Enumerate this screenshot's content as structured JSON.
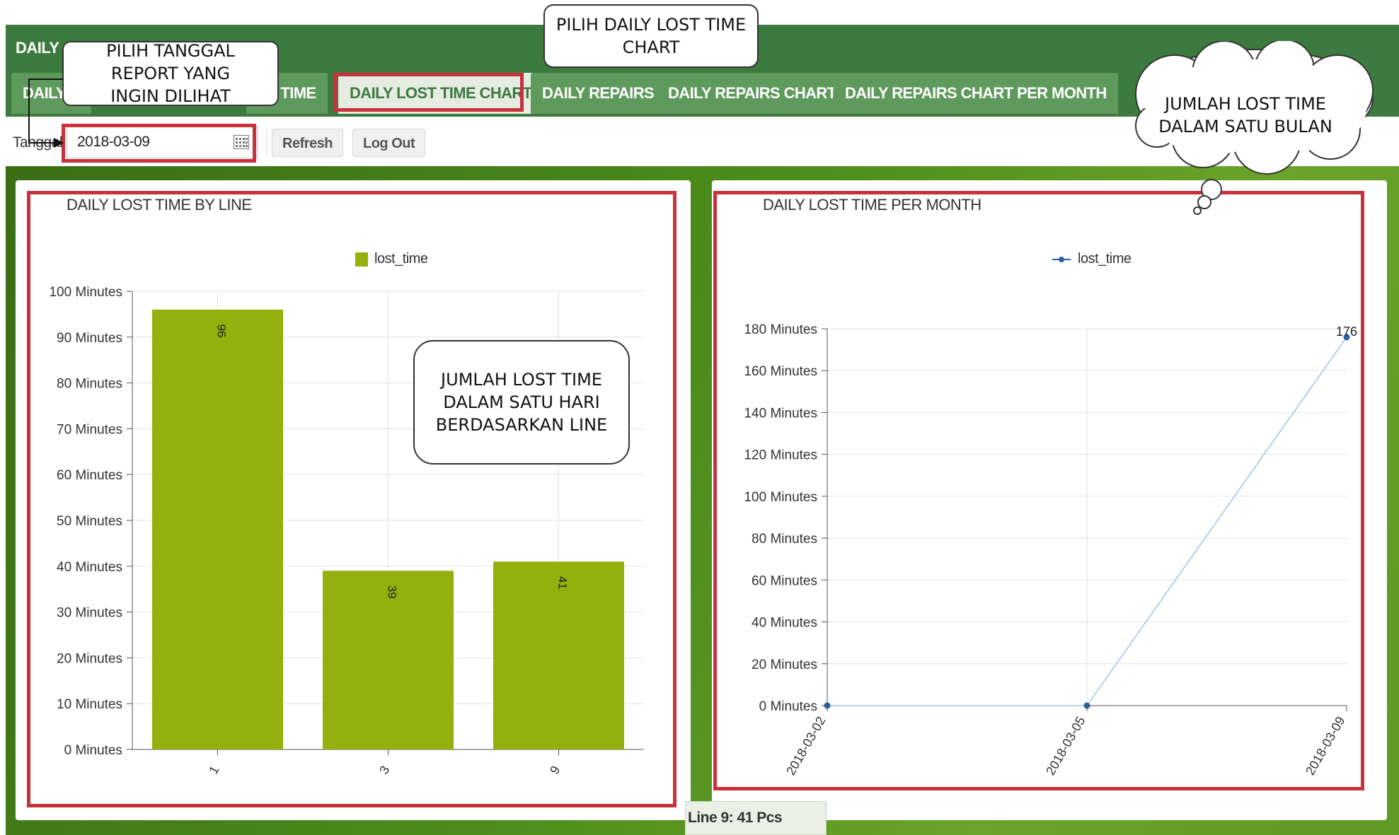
{
  "header": {
    "title": "DAILY C",
    "tabs": [
      {
        "label": "DAILY C"
      },
      {
        "label": "T TIME"
      },
      {
        "label": "DAILY LOST TIME CHART"
      },
      {
        "label": "DAILY REPAIRS"
      },
      {
        "label": "DAILY REPAIRS CHART"
      },
      {
        "label": "DAILY REPAIRS CHART PER MONTH"
      }
    ],
    "active_tab": "DAILY LOST TIME CHART"
  },
  "toolbar": {
    "date_label": "Tanggal",
    "date_value": "2018-03-09",
    "refresh_label": "Refresh",
    "logout_label": "Log Out"
  },
  "status_bar": {
    "text": "Line 9: 41 Pcs"
  },
  "annotations": {
    "pick_date": "PILIH TANGGAL REPORT YANG INGIN DILIHAT",
    "pick_chart": "PILIH DAILY LOST TIME CHART",
    "monthly_total": "JUMLAH LOST TIME DALAM SATU BULAN",
    "daily_by_line": "JUMLAH LOST TIME DALAM SATU HARI BERDASARKAN LINE"
  },
  "colors": {
    "header_green": "#3d7a3f",
    "bar_color": "#93b00c",
    "line_color": "#9ec3e6",
    "marker_color": "#2b5f9e",
    "highlight_red": "#c9313c"
  },
  "chart_data": [
    {
      "type": "bar",
      "title": "DAILY LOST TIME BY LINE",
      "categories": [
        "1",
        "3",
        "9"
      ],
      "series": [
        {
          "name": "lost_time",
          "values": [
            96,
            39,
            41
          ]
        }
      ],
      "data_labels": [
        "96",
        "39",
        "41"
      ],
      "ylim": [
        0,
        100
      ],
      "yticks": [
        0,
        10,
        20,
        30,
        40,
        50,
        60,
        70,
        80,
        90,
        100
      ],
      "y_tick_labels": [
        "0 Minutes",
        "10 Minutes",
        "20 Minutes",
        "30 Minutes",
        "40 Minutes",
        "50 Minutes",
        "60 Minutes",
        "70 Minutes",
        "80 Minutes",
        "90 Minutes",
        "100 Minutes"
      ],
      "legend_position": "top-center",
      "grid": true
    },
    {
      "type": "line",
      "title": "DAILY LOST TIME PER MONTH",
      "x": [
        "2018-03-02",
        "2018-03-05",
        "2018-03-09"
      ],
      "series": [
        {
          "name": "lost_time",
          "values": [
            0,
            0,
            176
          ]
        }
      ],
      "data_labels": [
        "",
        "",
        "176"
      ],
      "ylim": [
        0,
        180
      ],
      "yticks": [
        0,
        20,
        40,
        60,
        80,
        100,
        120,
        140,
        160,
        180
      ],
      "y_tick_labels": [
        "0 Minutes",
        "20 Minutes",
        "40 Minutes",
        "60 Minutes",
        "80 Minutes",
        "100 Minutes",
        "120 Minutes",
        "140 Minutes",
        "160 Minutes",
        "180 Minutes"
      ],
      "legend_position": "top-center",
      "grid": true
    }
  ]
}
